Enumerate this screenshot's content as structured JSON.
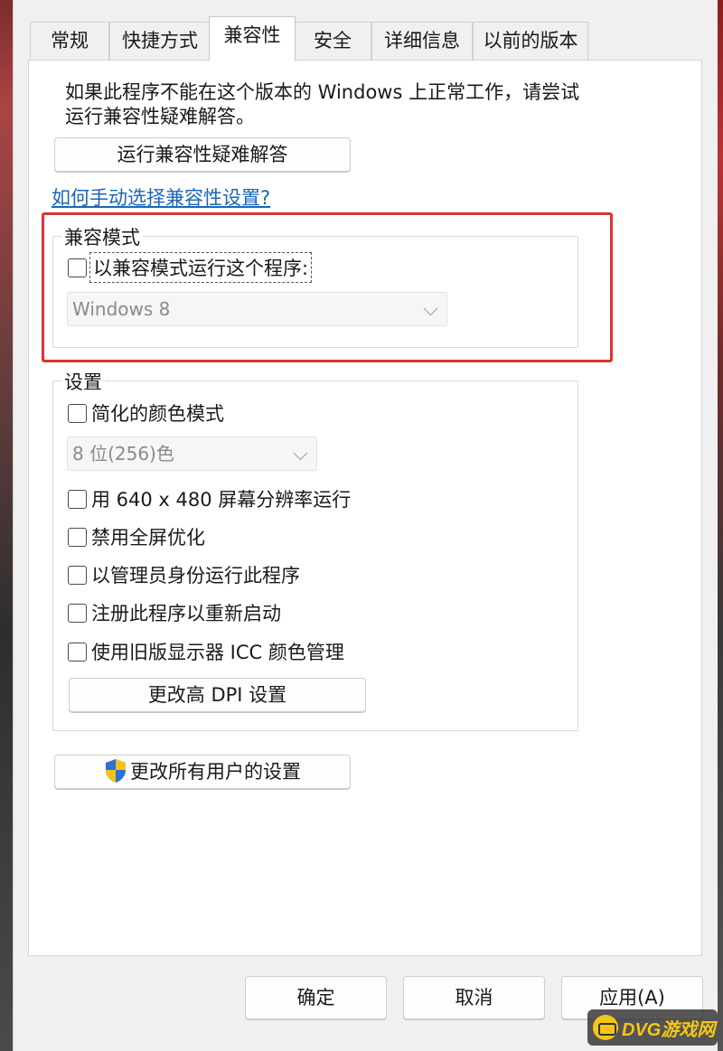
{
  "tabs": [
    "常规",
    "快捷方式",
    "兼容性",
    "安全",
    "详细信息",
    "以前的版本"
  ],
  "intro_line1": "如果此程序不能在这个版本的 Windows 上正常工作，请尝试",
  "intro_line2": "运行兼容性疑难解答。",
  "run_troubleshooter_button": "运行兼容性疑难解答",
  "manual_link": "如何手动选择兼容性设置?",
  "compat_mode": {
    "title": "兼容模式",
    "checkbox_label": "以兼容模式运行这个程序:",
    "os_select_value": "Windows 8",
    "highlight_color": "#d93434"
  },
  "settings": {
    "title": "设置",
    "reduced_color_label": "简化的颜色模式",
    "color_select_value": "8 位(256)色",
    "options": [
      "用 640 x 480 屏幕分辨率运行",
      "禁用全屏优化",
      "以管理员身份运行此程序",
      "注册此程序以重新启动",
      "使用旧版显示器 ICC 颜色管理"
    ],
    "dpi_button": "更改高 DPI 设置"
  },
  "all_users_button": "更改所有用户的设置",
  "all_users_icon": "uac-shield-icon",
  "footer": {
    "ok": "确定",
    "cancel": "取消",
    "apply": "应用(A)"
  },
  "watermark": "DVG游戏网",
  "colors": {
    "link": "#1a66b8",
    "accent_border": "#d93434"
  }
}
